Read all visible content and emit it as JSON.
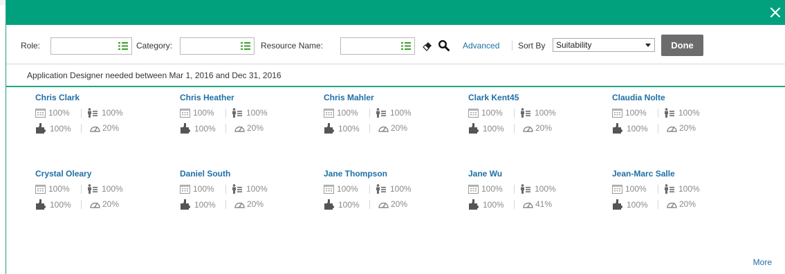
{
  "toolbar": {
    "role_label": "Role:",
    "category_label": "Category:",
    "resource_name_label": "Resource Name:",
    "advanced_label": "Advanced",
    "sort_by_label": "Sort By",
    "sort_by_value": "Suitability",
    "done_label": "Done"
  },
  "info_text": "Application Designer needed between Mar 1, 2016 and Dec 31, 2016",
  "resources": [
    {
      "name": "Chris Clark",
      "availability": "100%",
      "skill": "100%",
      "workload": "100%",
      "performance": "20%"
    },
    {
      "name": "Chris Heather",
      "availability": "100%",
      "skill": "100%",
      "workload": "100%",
      "performance": "20%"
    },
    {
      "name": "Chris Mahler",
      "availability": "100%",
      "skill": "100%",
      "workload": "100%",
      "performance": "20%"
    },
    {
      "name": "Clark Kent45",
      "availability": "100%",
      "skill": "100%",
      "workload": "100%",
      "performance": "20%"
    },
    {
      "name": "Claudia Nolte",
      "availability": "100%",
      "skill": "100%",
      "workload": "100%",
      "performance": "20%"
    },
    {
      "name": "Crystal Oleary",
      "availability": "100%",
      "skill": "100%",
      "workload": "100%",
      "performance": "20%"
    },
    {
      "name": "Daniel South",
      "availability": "100%",
      "skill": "100%",
      "workload": "100%",
      "performance": "20%"
    },
    {
      "name": "Jane Thompson",
      "availability": "100%",
      "skill": "100%",
      "workload": "100%",
      "performance": "20%"
    },
    {
      "name": "Jane Wu",
      "availability": "100%",
      "skill": "100%",
      "workload": "100%",
      "performance": "41%"
    },
    {
      "name": "Jean-Marc Salle",
      "availability": "100%",
      "skill": "100%",
      "workload": "100%",
      "performance": "20%"
    }
  ],
  "more_label": "More",
  "colors": {
    "header": "#00a17c",
    "link": "#1d6fa6",
    "done_button": "#6c6c6c"
  }
}
